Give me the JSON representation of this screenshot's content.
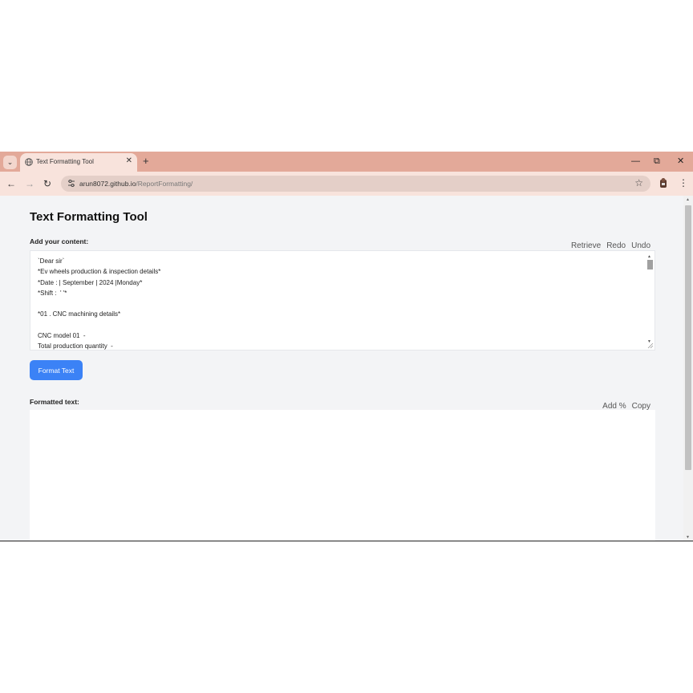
{
  "browser": {
    "tab": {
      "title": "Text Formatting Tool",
      "close_glyph": "✕"
    },
    "tab_search_glyph": "⌄",
    "new_tab_glyph": "+",
    "window": {
      "minimize": "—",
      "restore": "⧉",
      "close": "✕"
    },
    "nav": {
      "back": "←",
      "forward": "→",
      "reload": "↻"
    },
    "url": {
      "host": "arun8072.github.io",
      "path": "/ReportFormatting/"
    },
    "bookmark_glyph": "☆",
    "menu_glyph": "⋮"
  },
  "page": {
    "title": "Text Formatting Tool",
    "input_label": "Add your content:",
    "input_actions": [
      "Retrieve",
      "Redo",
      "Undo"
    ],
    "input_lines": [
      "`Dear sir`",
      "*Ev wheels production & inspection details*",
      "*Date : | September | 2024 |Monday*",
      "*Shift :  ' '*",
      "",
      "*01 . CNC machining details*",
      "",
      "CNC model 01  -",
      "Total production quantity  -"
    ],
    "format_button": "Format Text",
    "output_label": "Formatted text:",
    "output_actions": [
      "Add %",
      "Copy"
    ]
  },
  "colors": {
    "tab_strip": "#e3a999",
    "toolbar": "#f8e3dc",
    "omnibox": "#e4cfc8",
    "page_bg": "#f3f4f6",
    "primary_button": "#3b82f6"
  }
}
